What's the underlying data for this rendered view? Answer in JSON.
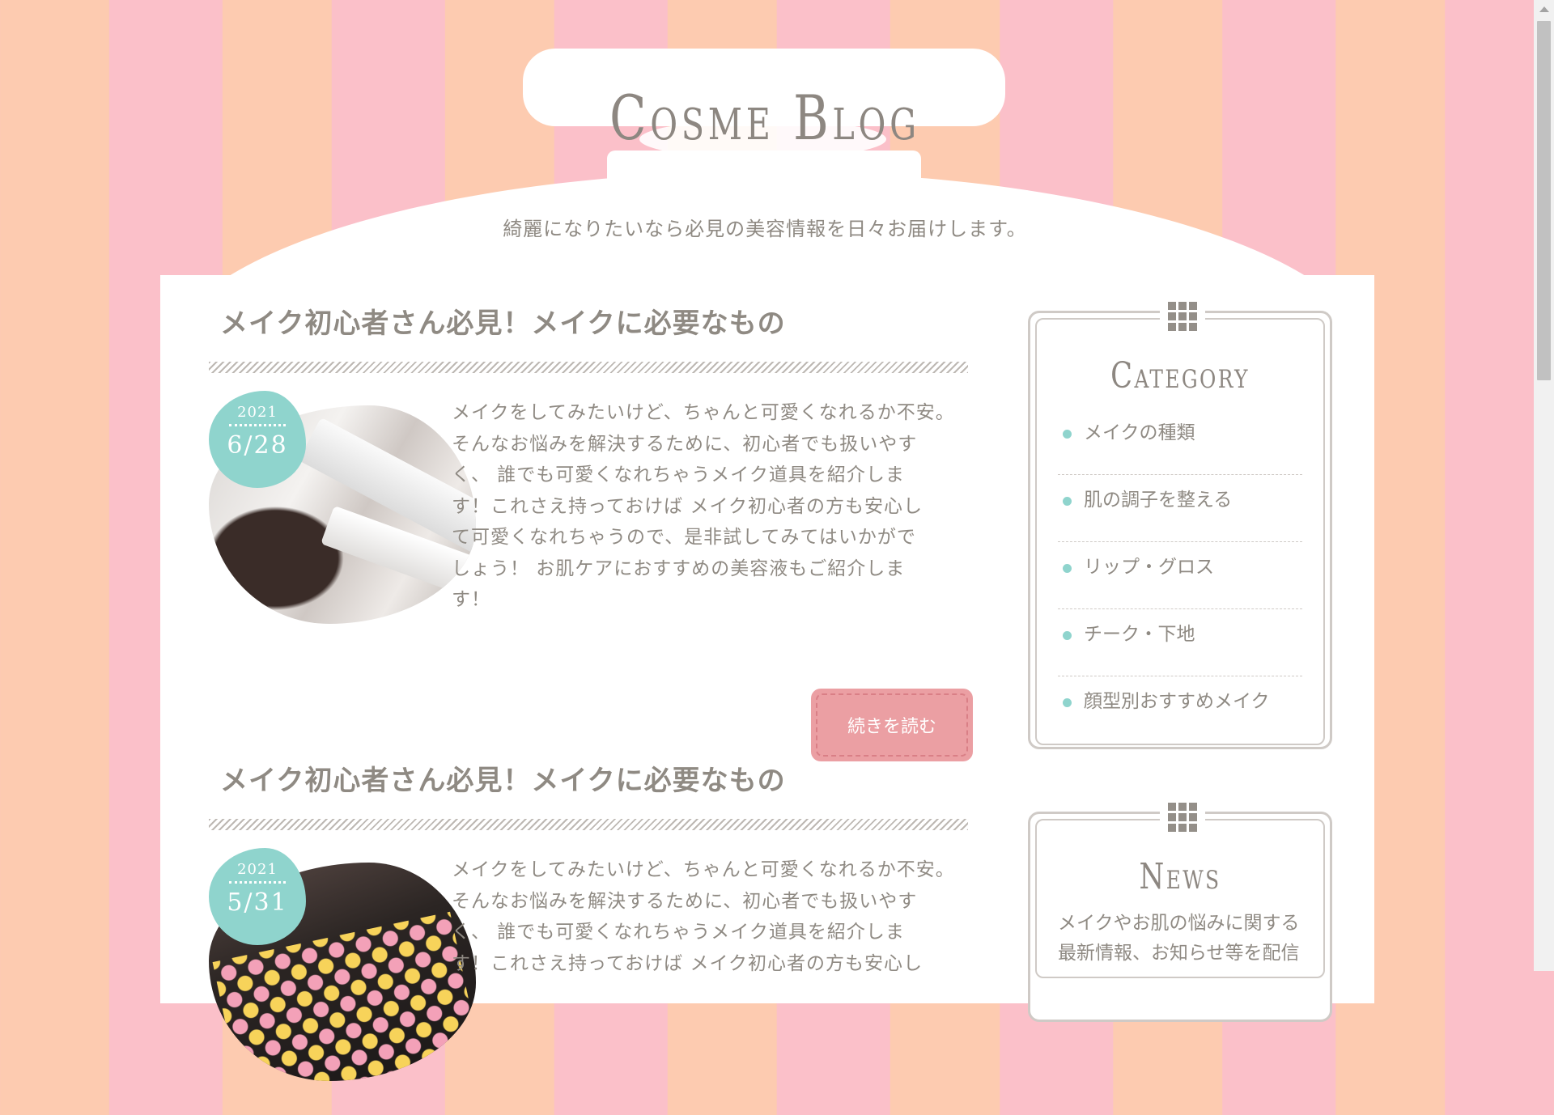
{
  "site": {
    "title": "Cosme Blog",
    "tagline": "綺麗になりたいなら必見の美容情報を日々お届けします。"
  },
  "articles": [
    {
      "title": "メイク初心者さん必見！メイクに必要なもの",
      "date_year": "2021",
      "date_day": "6/28",
      "excerpt": "メイクをしてみたいけど、ちゃんと可愛くなれるか不安。\nそんなお悩みを解決するために、初心者でも扱いやす\nく、 誰でも可愛くなれちゃうメイク道具を紹介しま\nす！これさえ持っておけば メイク初心者の方も安心し\nて可愛くなれちゃうので、是非試してみてはいかがで\nしょう！ お肌ケアにおすすめの美容液もご紹介しま\nす！",
      "more_label": "続きを読む",
      "image": "makeup-brushes"
    },
    {
      "title": "メイク初心者さん必見！メイクに必要なもの",
      "date_year": "2021",
      "date_day": "5/31",
      "excerpt": "メイクをしてみたいけど、ちゃんと可愛くなれるか不安。\nそんなお悩みを解決するために、初心者でも扱いやす\nく、 誰でも可愛くなれちゃうメイク道具を紹介しま\nす！これさえ持っておけば メイク初心者の方も安心し",
      "image": "eyeshadow-palette"
    }
  ],
  "sidebar": {
    "category": {
      "title": "Category",
      "icon": "grid-icon",
      "items": [
        "メイクの種類",
        "肌の調子を整える",
        "リップ・グロス",
        "チーク・下地",
        "顔型別おすすめメイク"
      ]
    },
    "news": {
      "title": "News",
      "icon": "grid-icon",
      "text": "メイクやお肌の悩みに関する最新情報、お知らせ等を配信"
    }
  },
  "colors": {
    "stripe_peach": "#fdcbb0",
    "stripe_pink": "#fbc0c9",
    "accent_mint": "#8fd4cd",
    "button_pink": "#eb9fa3",
    "text": "#8f8a83"
  }
}
